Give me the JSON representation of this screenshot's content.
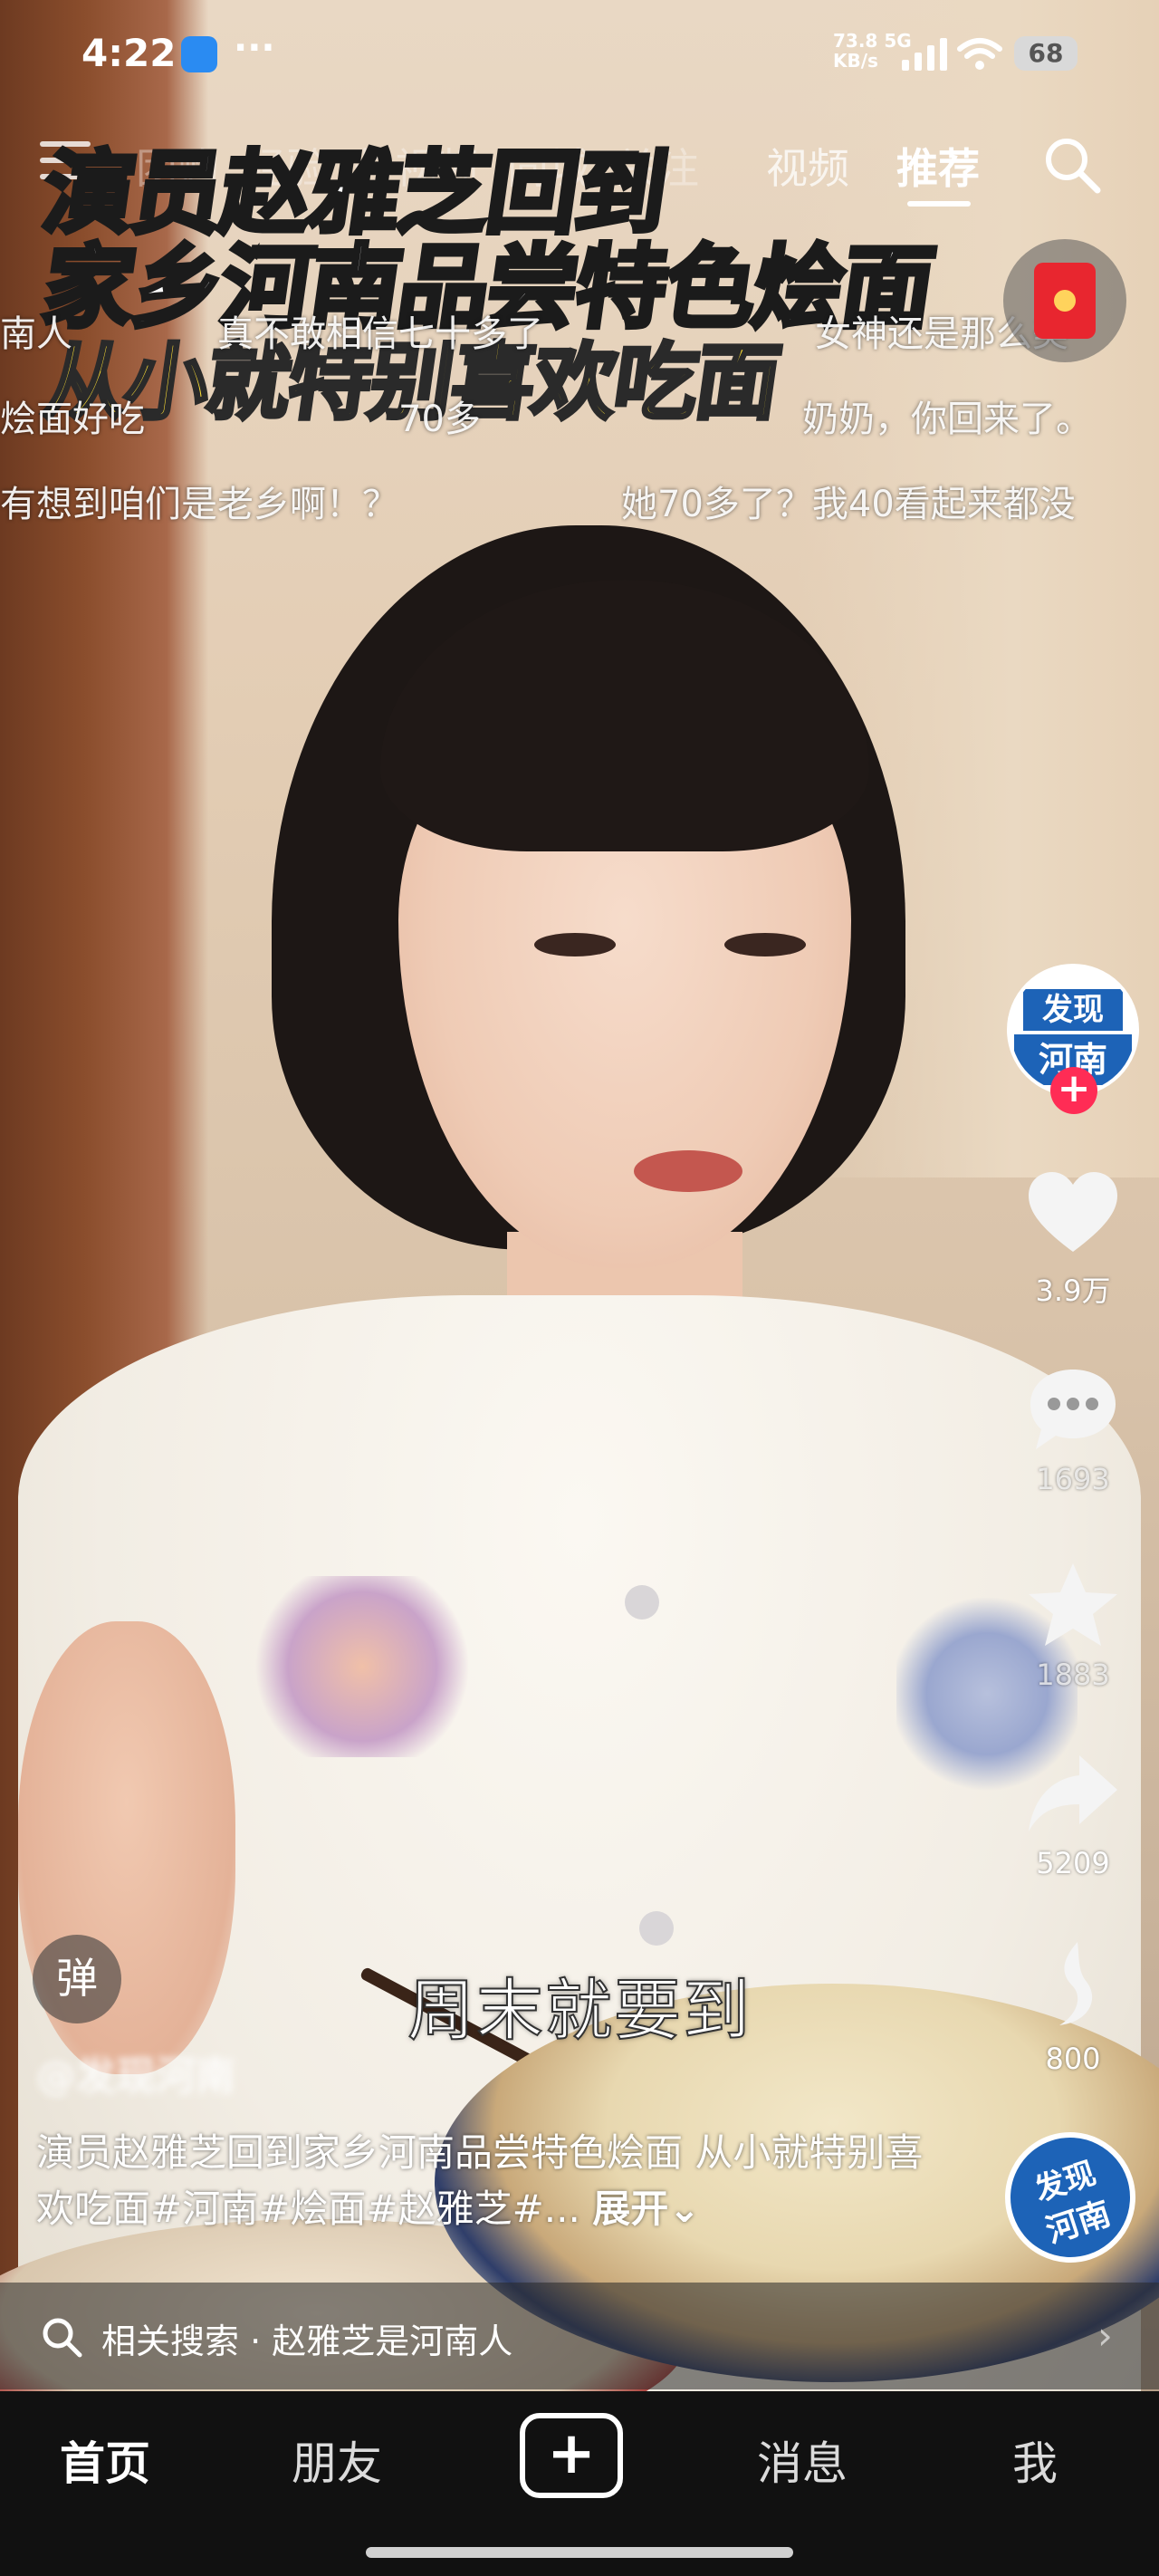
{
  "status_bar": {
    "time": "4:22",
    "dots": "···",
    "net_speed": "73.8",
    "net_unit": "KB/s",
    "net_type": "5G",
    "battery": "68"
  },
  "top_nav": {
    "tabs": [
      {
        "label": "团购",
        "state": "dim"
      },
      {
        "label": "经验",
        "state": "dim"
      },
      {
        "label": "长视频",
        "state": "dim"
      },
      {
        "label": "同城",
        "state": "dim"
      },
      {
        "label": "关注",
        "state": "dim"
      },
      {
        "label": "商城",
        "state": "dim"
      },
      {
        "label": "视频",
        "state": "normal"
      },
      {
        "label": "推荐",
        "state": "active"
      }
    ]
  },
  "video": {
    "title_line1": "演员赵雅芝回到",
    "title_line2": "家乡河南品尝特色烩面",
    "title_line3": "从小就特别喜欢吃面",
    "subtitle": "周末就要到"
  },
  "danmaku": [
    "南人",
    "真不敢相信七十多了",
    "女神还是那么美",
    "烩面好吃",
    "70多",
    "奶奶，你回来了。",
    "有想到咱们是老乡啊！？",
    "她70多了？我40看起来都没"
  ],
  "account": {
    "avatar_top": "发现",
    "avatar_bottom": "河南",
    "follow": "+"
  },
  "actions": {
    "likes": "3.9万",
    "comments": "1693",
    "favorites": "1883",
    "shares": "5209",
    "recommend": "800"
  },
  "danmu_toggle": "弹",
  "author_name": "@发现河南",
  "caption": {
    "text": "演员赵雅芝回到家乡河南品尝特色烩面 从小就特别喜欢吃面#河南#烩面#赵雅芝#...",
    "expand": "展开"
  },
  "related_search": {
    "label": "相关搜索 · 赵雅芝是河南人",
    "arrow": "›"
  },
  "music_disc": {
    "line1": "发现",
    "line2": "河南"
  },
  "tab_bar": {
    "home": "首页",
    "friends": "朋友",
    "create": "+",
    "messages": "消息",
    "me": "我"
  },
  "colors": {
    "accent_red": "#ff2c55",
    "title_yellow": "#ffe135",
    "brand_blue": "#1d63b7"
  }
}
